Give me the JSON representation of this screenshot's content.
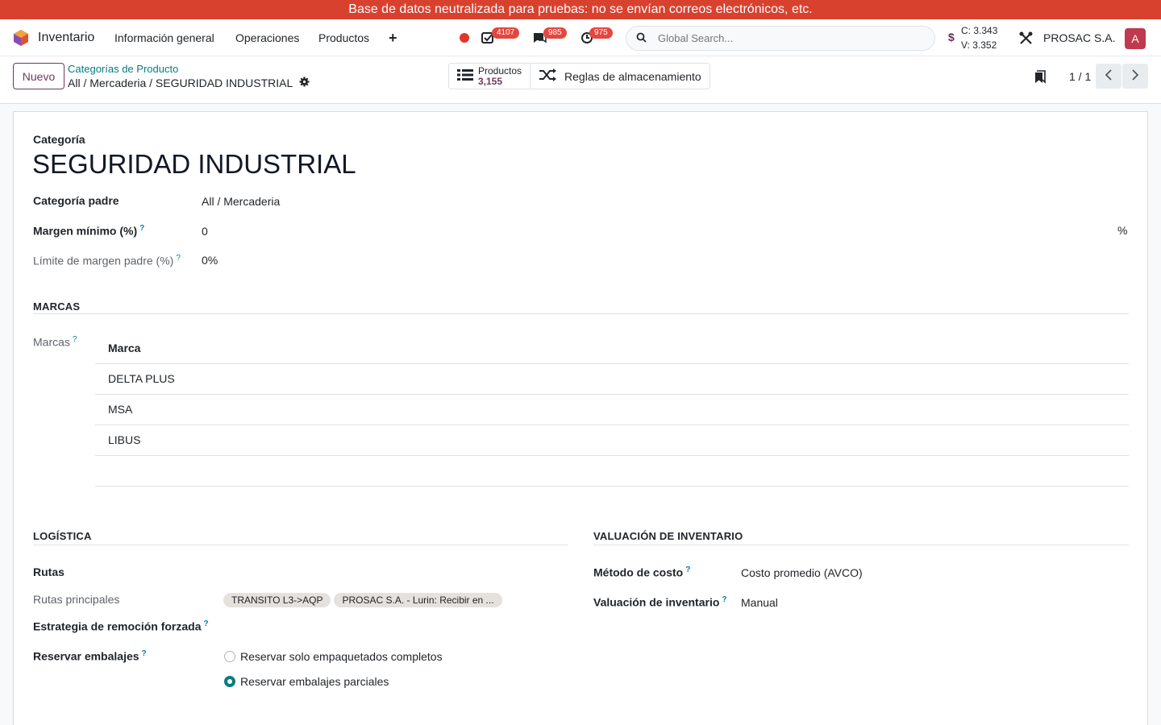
{
  "banner": "Base de datos neutralizada para pruebas: no se envían correos electrónicos, etc.",
  "navbar": {
    "app_name": "Inventario",
    "menu": [
      "Información general",
      "Operaciones",
      "Productos"
    ],
    "badges": {
      "activities": "4107",
      "messages": "985",
      "clock": "975"
    },
    "search_placeholder": "Global Search...",
    "currency_symbol": "$",
    "rate_buy": "C: 3.343",
    "rate_sell": "V: 3.352",
    "company": "PROSAC S.A.",
    "avatar_letter": "A"
  },
  "control": {
    "new_label": "Nuevo",
    "breadcrumb_parent": "Categorías de Producto",
    "breadcrumb_current": "All / Mercaderia / SEGURIDAD INDUSTRIAL",
    "smart_products_label": "Productos",
    "smart_products_count": "3,155",
    "smart_rules_label": "Reglas de almacenamiento",
    "pager": "1 / 1"
  },
  "form": {
    "category_label": "Categoría",
    "category_name": "SEGURIDAD INDUSTRIAL",
    "parent_label": "Categoría padre",
    "parent_value": "All / Mercaderia",
    "min_margin_label": "Margen mínimo (%)",
    "min_margin_value": "0",
    "percent_sign": "%",
    "parent_margin_label": "Límite de margen padre (%)",
    "parent_margin_value": "0%",
    "help_mark": "?",
    "brands_section": "MARCAS",
    "brands_label": "Marcas",
    "brands_column": "Marca",
    "brands": [
      "DELTA PLUS",
      "MSA",
      "LIBUS"
    ],
    "logistics_section": "LOGÍSTICA",
    "routes_label": "Rutas",
    "main_routes_label": "Rutas principales",
    "main_routes": [
      "TRANSITO L3->AQP",
      "PROSAC S.A. - Lurin: Recibir en ..."
    ],
    "removal_label": "Estrategia de remoción forzada",
    "packaging_label": "Reservar embalajes",
    "packaging_options": [
      "Reservar solo empaquetados completos",
      "Reservar embalajes parciales"
    ],
    "packaging_selected": "Reservar embalajes parciales",
    "valuation_section": "VALUACIÓN DE INVENTARIO",
    "cost_method_label": "Método de costo",
    "cost_method_value": "Costo promedio (AVCO)",
    "valuation_label": "Valuación de inventario",
    "valuation_value": "Manual"
  },
  "colors": {
    "banner": "#d9412f",
    "primary": "#71375f",
    "link": "#017e84",
    "badge": "#e4473f"
  }
}
